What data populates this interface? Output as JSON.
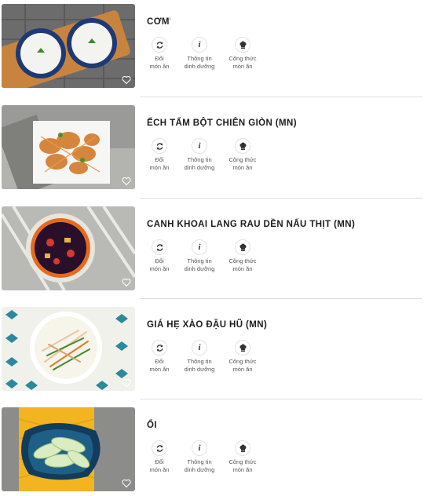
{
  "dishes": [
    {
      "name": "CƠM",
      "image": "steamed-rice",
      "has_info_marker": true
    },
    {
      "name": "ẾCH TẨM BỘT CHIÊN GIÒN (MN)",
      "image": "fried-frog"
    },
    {
      "name": "CANH KHOAI LANG RAU DỀN NẤU THỊT (MN)",
      "image": "amaranth-sweet-potato-soup"
    },
    {
      "name": "GIÁ HẸ XÀO ĐẬU HŨ (MN)",
      "image": "stir-fried-bean-sprouts-tofu"
    },
    {
      "name": "ỔI",
      "image": "sliced-guava"
    }
  ],
  "actions": {
    "swap_line1": "Đổi",
    "swap_line2": "món ăn",
    "info_line1": "Thông tin",
    "info_line2": "dinh dưỡng",
    "recipe_line1": "Công thức",
    "recipe_line2": "món ăn"
  },
  "marker": "i",
  "icons": {
    "swap": "swap-icon",
    "info": "info-icon",
    "recipe": "chef-hat-icon",
    "favorite": "heart-icon"
  },
  "colors": {
    "separator": "#dedede",
    "title": "#1d1d1d",
    "label": "#555555"
  }
}
